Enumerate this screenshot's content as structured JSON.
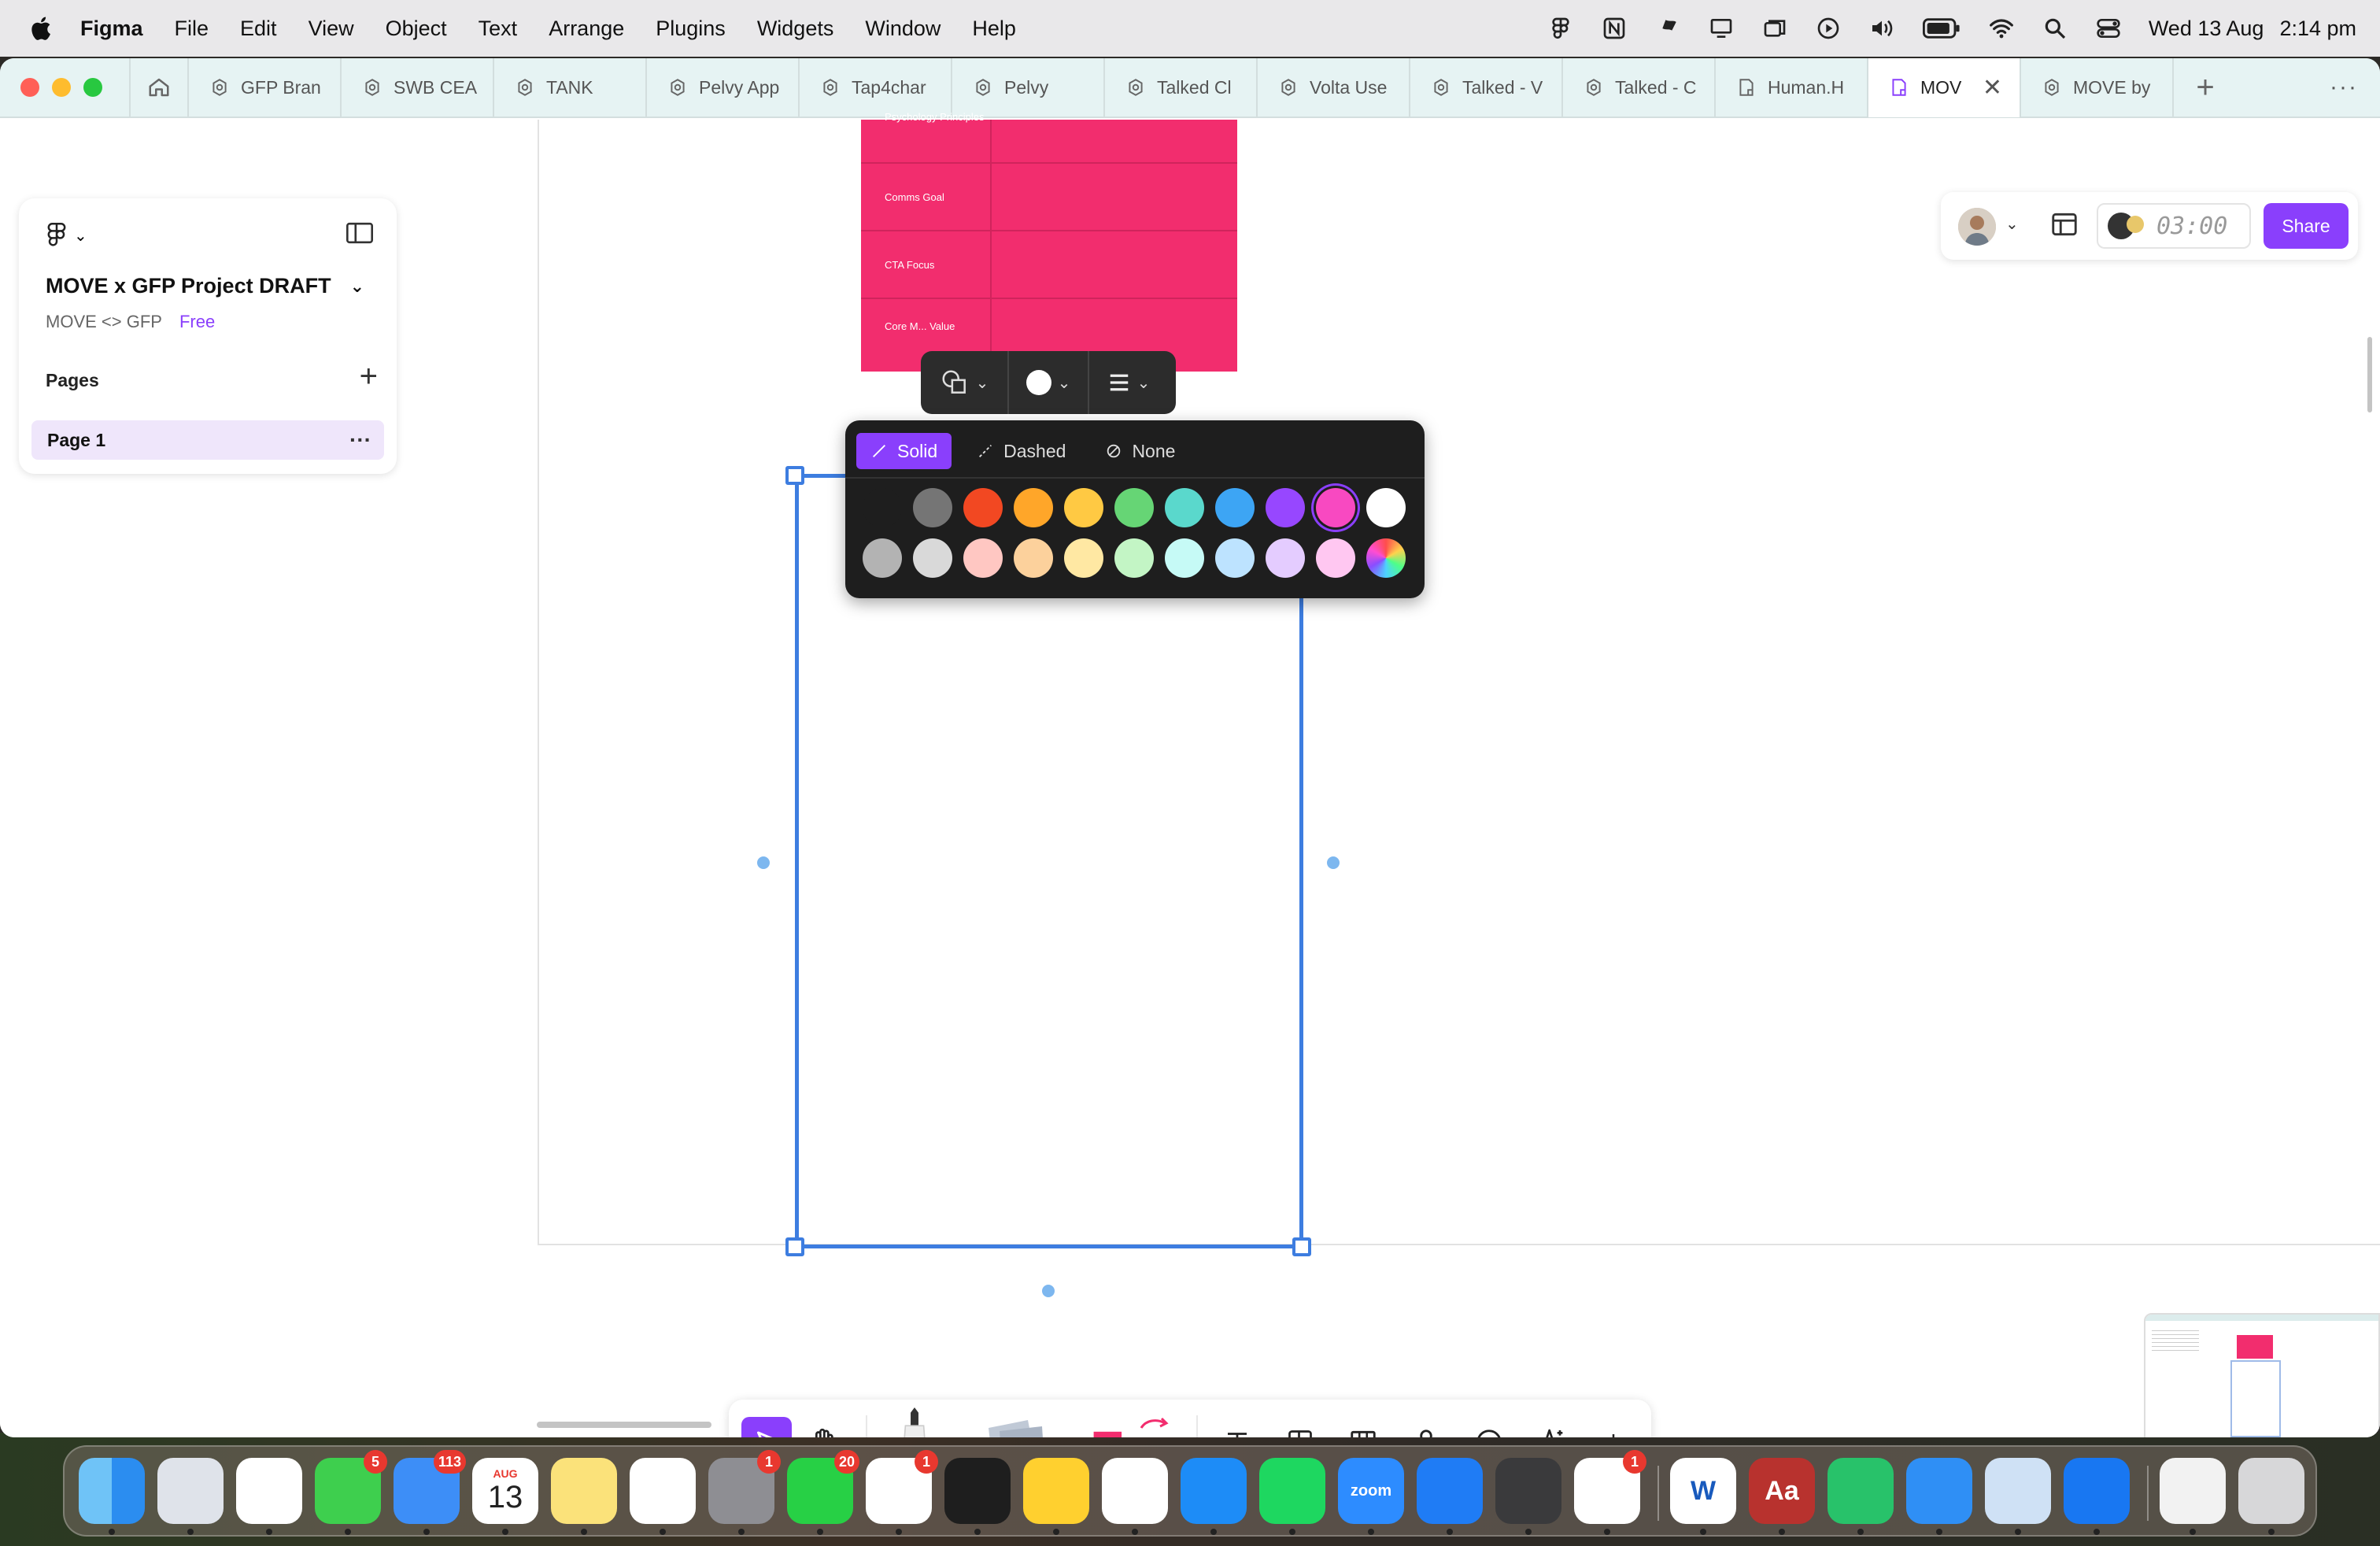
{
  "menubar": {
    "app_name": "Figma",
    "items": [
      "File",
      "Edit",
      "View",
      "Object",
      "Text",
      "Arrange",
      "Plugins",
      "Widgets",
      "Window",
      "Help"
    ],
    "date": "Wed 13 Aug",
    "time": "2:14 pm"
  },
  "tabs": [
    {
      "label": "GFP Bran",
      "icon": "figjam-icon"
    },
    {
      "label": "SWB CEA",
      "icon": "figjam-icon"
    },
    {
      "label": "TANK",
      "icon": "figjam-icon"
    },
    {
      "label": "Pelvy App",
      "icon": "figjam-icon"
    },
    {
      "label": "Tap4char",
      "icon": "figjam-icon"
    },
    {
      "label": "Pelvy",
      "icon": "figjam-icon"
    },
    {
      "label": "Talked Cl",
      "icon": "figjam-icon"
    },
    {
      "label": "Volta Use",
      "icon": "figjam-icon"
    },
    {
      "label": "Talked - V",
      "icon": "figjam-icon"
    },
    {
      "label": "Talked - C",
      "icon": "figjam-icon"
    },
    {
      "label": "Human.H",
      "icon": "figjam-icon"
    },
    {
      "label": "MOV",
      "icon": "figjam-icon",
      "active": true
    },
    {
      "label": "MOVE by",
      "icon": "figjam-icon"
    }
  ],
  "left_panel": {
    "file_title": "MOVE x GFP Project DRAFT",
    "project": "MOVE <> GFP",
    "plan_badge": "Free",
    "pages_label": "Pages",
    "pages": [
      {
        "label": "Page 1",
        "selected": true
      }
    ]
  },
  "top_right": {
    "timer": "03:00",
    "share_label": "Share"
  },
  "pink_table": {
    "rows": [
      "Psychology Principles",
      "Comms Goal",
      "CTA Focus",
      "Core M... Value"
    ],
    "color": "#f22d6e"
  },
  "stroke_popup": {
    "styles": [
      {
        "label": "Solid",
        "active": true
      },
      {
        "label": "Dashed",
        "active": false
      },
      {
        "label": "None",
        "active": false
      }
    ],
    "colors_row1": [
      "#1e1e1e",
      "#757575",
      "#f24822",
      "#ffa629",
      "#ffc943",
      "#66d575",
      "#5ad8cc",
      "#3da5f4",
      "#9747ff",
      "#f849c1",
      "#ffffff"
    ],
    "colors_row2": [
      "#b3b3b3",
      "#d9d9d9",
      "#ffc7c2",
      "#fcd19c",
      "#ffe8a3",
      "#c3f5c5",
      "#c6faf6",
      "#bde3ff",
      "#e4ccff",
      "#ffc7f1",
      "rainbow"
    ],
    "selected_color": "#f849c1"
  },
  "accent_color": "#8a3ffc",
  "selection_color": "#3d7de0",
  "dock": {
    "apps": [
      {
        "name": "Finder",
        "badge": ""
      },
      {
        "name": "Launchpad",
        "badge": ""
      },
      {
        "name": "Chrome",
        "badge": ""
      },
      {
        "name": "Messages",
        "badge": "5"
      },
      {
        "name": "Mail",
        "badge": "113"
      },
      {
        "name": "Calendar",
        "badge": "",
        "month": "AUG",
        "day": "13"
      },
      {
        "name": "Notes",
        "badge": ""
      },
      {
        "name": "Notion",
        "badge": ""
      },
      {
        "name": "System Settings",
        "badge": "1"
      },
      {
        "name": "WhatsApp",
        "badge": "20"
      },
      {
        "name": "Slack",
        "badge": "1"
      },
      {
        "name": "Figma",
        "badge": ""
      },
      {
        "name": "Miro",
        "badge": ""
      },
      {
        "name": "Photos",
        "badge": ""
      },
      {
        "name": "App Store",
        "badge": ""
      },
      {
        "name": "Spotify",
        "badge": ""
      },
      {
        "name": "Zoom",
        "badge": "",
        "label": "zoom"
      },
      {
        "name": "Bluetooth",
        "badge": ""
      },
      {
        "name": "Calculator",
        "badge": ""
      },
      {
        "name": "Reminders",
        "badge": "1"
      },
      {
        "name": "Word",
        "badge": "",
        "label": "W"
      },
      {
        "name": "Dictionary",
        "badge": "",
        "label": "Aa"
      },
      {
        "name": "Find My",
        "badge": ""
      },
      {
        "name": "Safari",
        "badge": ""
      },
      {
        "name": "Preview",
        "badge": ""
      },
      {
        "name": "Screen app",
        "badge": ""
      },
      {
        "name": "Documents",
        "badge": ""
      },
      {
        "name": "Trash",
        "badge": ""
      }
    ]
  }
}
